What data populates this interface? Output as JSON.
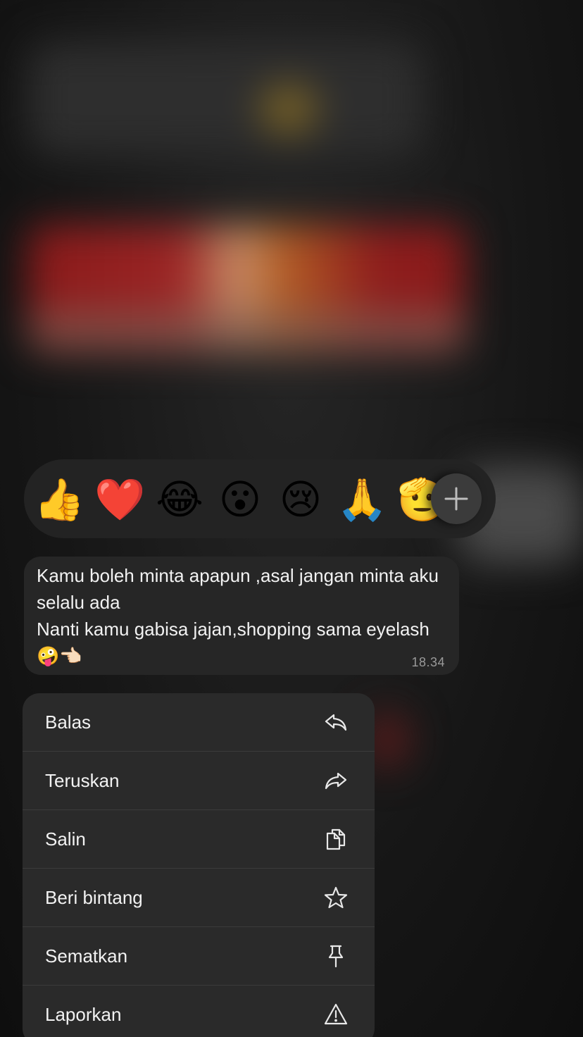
{
  "reactions": {
    "emojis": [
      "👍",
      "❤️",
      "😂",
      "😮",
      "😢",
      "🙏",
      "🫡"
    ],
    "more_icon": "plus-icon"
  },
  "message": {
    "text": "Kamu boleh minta apapun ,asal jangan minta aku selalu ada\nNanti kamu gabisa jajan,shopping sama eyelash 🤪👈🏻",
    "time": "18.34"
  },
  "menu": {
    "items": [
      {
        "label": "Balas",
        "icon": "reply-icon"
      },
      {
        "label": "Teruskan",
        "icon": "forward-icon"
      },
      {
        "label": "Salin",
        "icon": "copy-icon"
      },
      {
        "label": "Beri bintang",
        "icon": "star-icon"
      },
      {
        "label": "Sematkan",
        "icon": "pin-icon"
      },
      {
        "label": "Laporkan",
        "icon": "warning-icon"
      }
    ]
  }
}
